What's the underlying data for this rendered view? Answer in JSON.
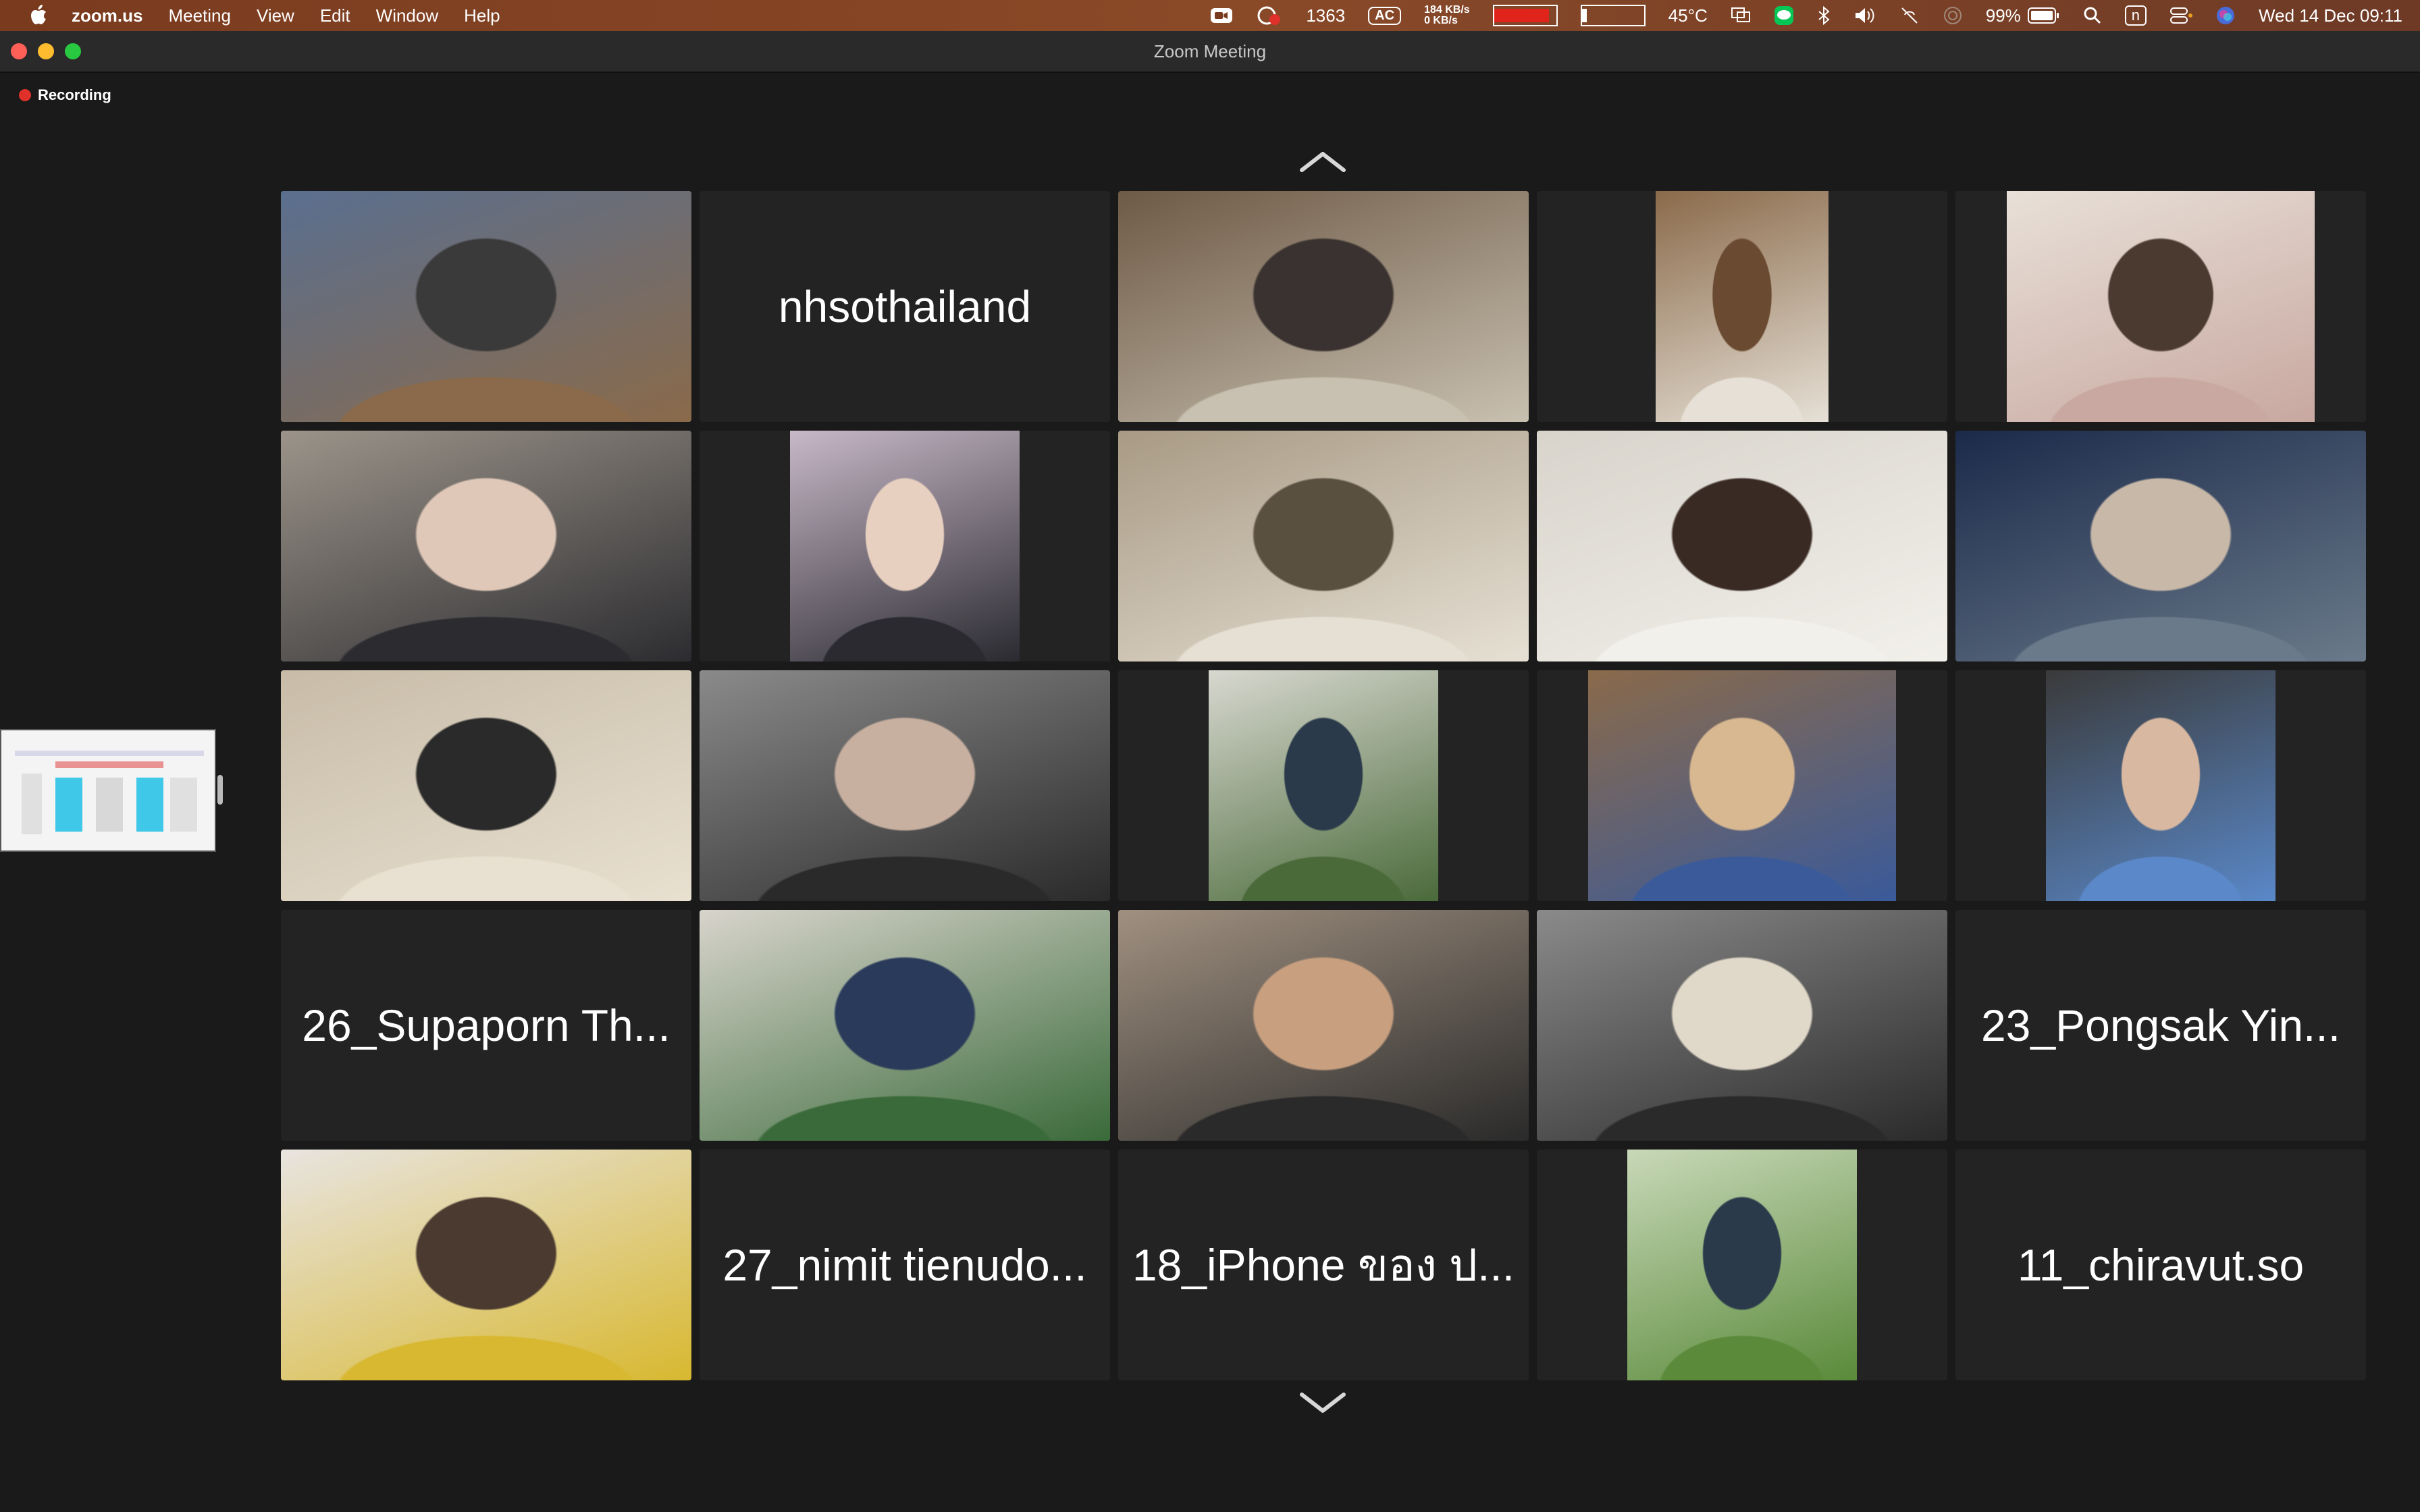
{
  "menubar": {
    "app_name": "zoom.us",
    "items": [
      "Meeting",
      "View",
      "Edit",
      "Window",
      "Help"
    ],
    "status": {
      "counter": "1363",
      "ac_badge": "AC",
      "net_up": "184 KB/s",
      "net_down": "0 KB/s",
      "temperature": "45°C",
      "battery_percent": "99%",
      "datetime": "Wed 14 Dec  09:11",
      "n_badge": "n"
    }
  },
  "window": {
    "title": "Zoom Meeting"
  },
  "recording": {
    "label": "Recording",
    "dot_color": "#e0302a"
  },
  "gallery": {
    "tiles": [
      {
        "type": "video",
        "desc": "meeting-room",
        "colors": [
          "#5a6f8f",
          "#8a6a4a",
          "#3a3a3a"
        ],
        "active": true
      },
      {
        "type": "name",
        "label": "nhsothailand"
      },
      {
        "type": "video",
        "desc": "man-in-office",
        "colors": [
          "#6e5a46",
          "#c8c0b0",
          "#3a3230"
        ]
      },
      {
        "type": "video",
        "desc": "man-in-white-coat",
        "colors": [
          "#8a6a4a",
          "#e6e0d6",
          "#6a4a30"
        ],
        "photo_left": 0.29,
        "photo_width": 0.42
      },
      {
        "type": "video",
        "desc": "woman-with-glasses",
        "colors": [
          "#e8e0d8",
          "#c8a8a0",
          "#4a3a30"
        ],
        "photo_left": 0.125,
        "photo_width": 0.75
      },
      {
        "type": "video",
        "desc": "man-with-glasses",
        "colors": [
          "#9c948a",
          "#2c2c30",
          "#e0c8b8"
        ]
      },
      {
        "type": "video",
        "desc": "man-in-suit-arms-crossed",
        "colors": [
          "#c8b8c8",
          "#2a2a30",
          "#e8d0c0"
        ],
        "photo_left": 0.22,
        "photo_width": 0.56
      },
      {
        "type": "video",
        "desc": "military-officer",
        "colors": [
          "#a89a84",
          "#e6e0d4",
          "#5a5040"
        ]
      },
      {
        "type": "video",
        "desc": "woman-by-window",
        "colors": [
          "#d8d4cc",
          "#f2f0ea",
          "#3a2a24"
        ]
      },
      {
        "type": "video",
        "desc": "nested-zoom-gallery",
        "colors": [
          "#1c2a4a",
          "#6a7a8a",
          "#c8b8a8"
        ]
      },
      {
        "type": "video",
        "desc": "empty-room",
        "colors": [
          "#c8bca8",
          "#e8e0d0",
          "#2a2a2a"
        ]
      },
      {
        "type": "video",
        "desc": "woman-reading",
        "colors": [
          "#8a8a8a",
          "#2a2a2a",
          "#c8b0a0"
        ]
      },
      {
        "type": "video",
        "desc": "woman-by-statue",
        "colors": [
          "#d8d8d0",
          "#4a6a3a",
          "#2a3a4a"
        ],
        "photo_left": 0.22,
        "photo_width": 0.56
      },
      {
        "type": "video",
        "desc": "man-in-blue-shirt",
        "colors": [
          "#8a6a4a",
          "#3a5a9a",
          "#d8b890"
        ],
        "photo_left": 0.125,
        "photo_width": 0.75
      },
      {
        "type": "video",
        "desc": "older-man",
        "colors": [
          "#3a3a3a",
          "#5a88c8",
          "#d8b8a0"
        ],
        "photo_left": 0.22,
        "photo_width": 0.56
      },
      {
        "type": "name",
        "label": "26_Supaporn Th..."
      },
      {
        "type": "video",
        "desc": "woman-with-plant",
        "colors": [
          "#d8d4cc",
          "#3a6a3a",
          "#2a3a5a"
        ]
      },
      {
        "type": "video",
        "desc": "man-with-scarf",
        "colors": [
          "#a09080",
          "#2a2a2a",
          "#c8a080"
        ]
      },
      {
        "type": "video",
        "desc": "man-with-phone",
        "colors": [
          "#8a8a8a",
          "#2a2a2a",
          "#e0d8c8"
        ]
      },
      {
        "type": "name",
        "label": "23_Pongsak Yin..."
      },
      {
        "type": "video",
        "desc": "man-in-yellow",
        "colors": [
          "#e8e4e0",
          "#d8b830",
          "#4a3a30"
        ]
      },
      {
        "type": "name",
        "label": "27_nimit tienudo..."
      },
      {
        "type": "name",
        "label": "18_iPhone ของ ป..."
      },
      {
        "type": "video",
        "desc": "man-smelling-plant",
        "colors": [
          "#c8d8b8",
          "#5a8a3a",
          "#2a3a4a"
        ],
        "photo_left": 0.22,
        "photo_width": 0.56
      },
      {
        "type": "name",
        "label": "11_chiravut.so"
      }
    ]
  },
  "icons": {
    "scroll_up": "chevron-up-icon",
    "scroll_down": "chevron-down-icon",
    "apple": "apple-icon"
  }
}
